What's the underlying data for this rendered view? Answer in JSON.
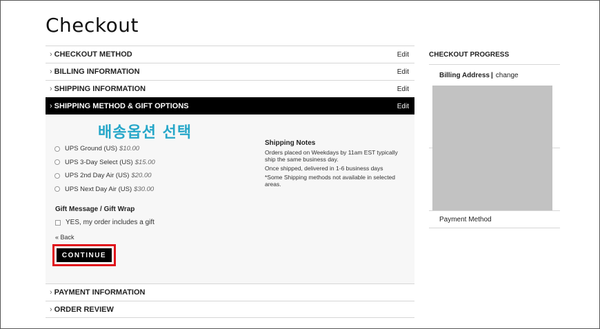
{
  "page": {
    "title": "Checkout"
  },
  "steps": {
    "checkout_method": {
      "label": "CHECKOUT METHOD",
      "edit": "Edit"
    },
    "billing": {
      "label": "BILLING INFORMATION",
      "edit": "Edit"
    },
    "shipping": {
      "label": "SHIPPING INFORMATION",
      "edit": "Edit"
    },
    "shipping_method": {
      "label": "SHIPPING METHOD & GIFT OPTIONS",
      "edit": "Edit"
    },
    "payment": {
      "label": "PAYMENT INFORMATION"
    },
    "review": {
      "label": "ORDER REVIEW"
    }
  },
  "panel": {
    "annotation": "배송옵션 선택",
    "methods": [
      {
        "name": "UPS Ground (US)",
        "price": "$10.00"
      },
      {
        "name": "UPS 3-Day Select (US)",
        "price": "$15.00"
      },
      {
        "name": "UPS 2nd Day Air (US)",
        "price": "$20.00"
      },
      {
        "name": "UPS Next Day Air (US)",
        "price": "$30.00"
      }
    ],
    "notes": {
      "title": "Shipping Notes",
      "lines": [
        "Orders placed on Weekdays by 11am EST typically ship the same business day.",
        "Once shipped, delivered in 1-6 business days",
        "*Some Shipping methods not available in selected areas."
      ]
    },
    "gift": {
      "title": "Gift Message / Gift Wrap",
      "checkbox_label": "YES, my order includes a gift"
    },
    "back_label": "« Back",
    "continue_label": "CONTINUE"
  },
  "sidebar": {
    "title": "CHECKOUT PROGRESS",
    "billing_label": "Billing Address",
    "separator": "|",
    "change_label": "change",
    "payment_label": "Payment Method"
  },
  "colors": {
    "accent": "#000000",
    "annotation": "#27a7c9",
    "highlight_border": "#e0111a",
    "panel_bg": "#f7f7f7",
    "redaction": "#c2c2c2"
  }
}
